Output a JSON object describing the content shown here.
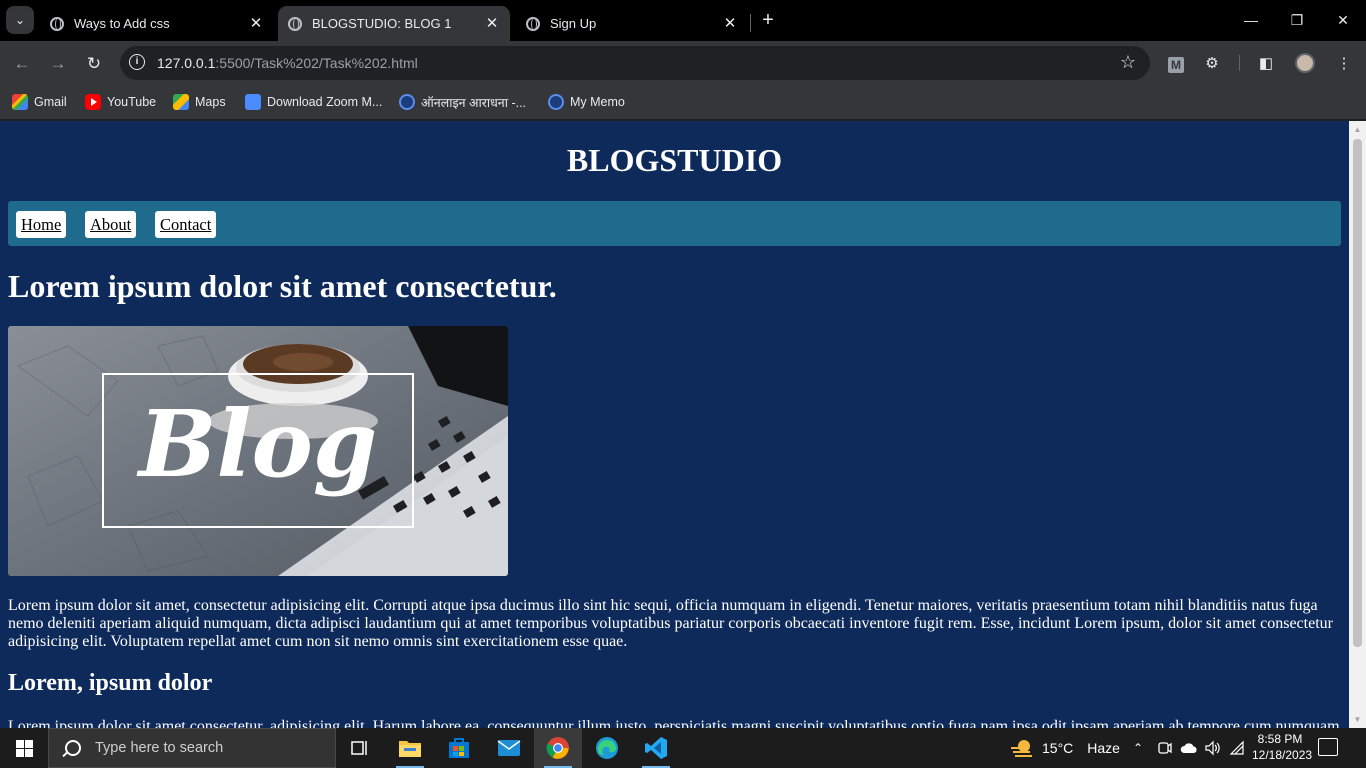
{
  "browser": {
    "tabs": [
      {
        "title": "Ways to Add css",
        "active": false
      },
      {
        "title": "BLOGSTUDIO: BLOG 1",
        "active": true
      },
      {
        "title": "Sign Up",
        "active": false
      }
    ],
    "url": {
      "host": "127.0.0.1",
      "rest": ":5500/Task%202/Task%202.html"
    },
    "bookmarks": [
      {
        "label": "Gmail",
        "icon": "gmail-icon"
      },
      {
        "label": "YouTube",
        "icon": "youtube-icon"
      },
      {
        "label": "Maps",
        "icon": "maps-icon"
      },
      {
        "label": "Download Zoom M...",
        "icon": "zoom-icon"
      },
      {
        "label": "ऑनलाइन आराधना -...",
        "icon": "globe-icon"
      },
      {
        "label": "My Memo",
        "icon": "globe-icon"
      }
    ],
    "extension_label": "M"
  },
  "page": {
    "site_title": "BLOGSTUDIO",
    "nav": [
      "Home",
      "About",
      "Contact"
    ],
    "post_title": "Lorem ipsum dolor sit amet consectetur.",
    "hero_text": "Blog",
    "paragraph1": "Lorem ipsum dolor sit amet, consectetur adipisicing elit. Corrupti atque ipsa ducimus illo sint hic sequi, officia numquam in eligendi. Tenetur maiores, veritatis praesentium totam nihil blanditiis natus fuga nemo deleniti aperiam aliquid numquam, dicta adipisci laudantium qui at amet temporibus voluptatibus pariatur corporis obcaecati inventore fugit rem. Esse, incidunt Lorem ipsum, dolor sit amet consectetur adipisicing elit. Voluptatem repellat amet cum non sit nemo omnis sint exercitationem esse quae.",
    "subheading": "Lorem, ipsum dolor",
    "paragraph2": "Lorem ipsum dolor sit amet consectetur, adipisicing elit. Harum labore ea, consequuntur illum iusto, perspiciatis magni suscipit voluptatibus optio fuga nam ipsa odit ipsam aperiam ab tempore cum numquam",
    "colors": {
      "background": "#0e2a5b",
      "nav_bar": "#1f6b8e",
      "nav_link_bg": "#ffffff"
    }
  },
  "taskbar": {
    "search_placeholder": "Type here to search",
    "weather": {
      "temp": "15°C",
      "condition": "Haze"
    },
    "time": "8:58 PM",
    "date": "12/18/2023"
  }
}
